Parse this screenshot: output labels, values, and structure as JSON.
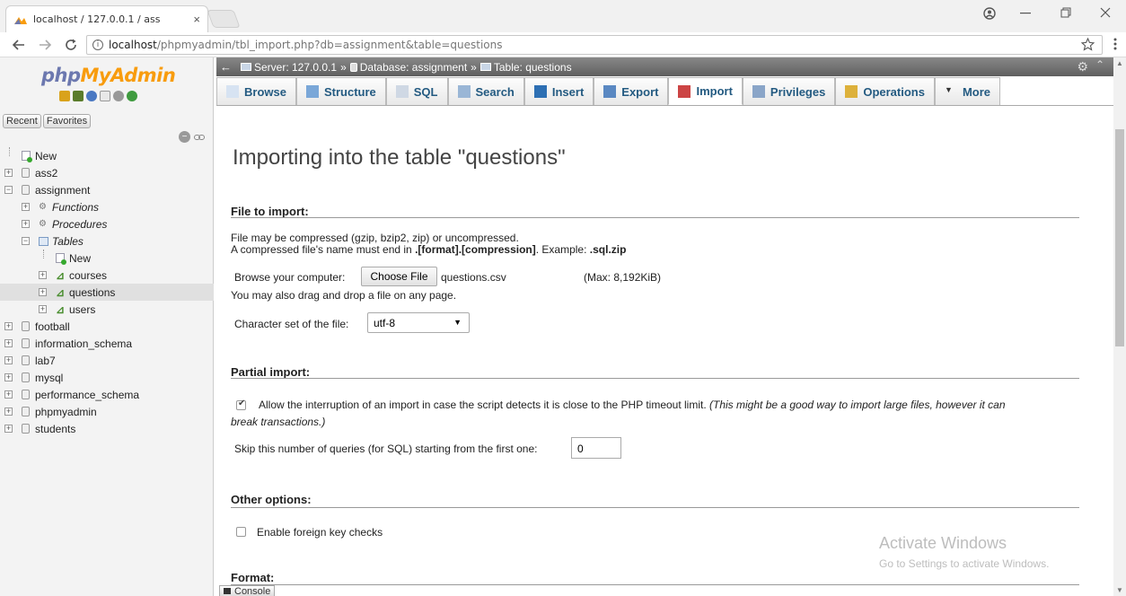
{
  "browser": {
    "tab_title": "localhost / 127.0.0.1 / ass",
    "tab_close": "×",
    "url_host": "localhost",
    "url_path": "/phpmyadmin/tbl_import.php?db=assignment&table=questions",
    "info_glyph": "i",
    "icons": [
      "phpmyadmin-favicon",
      "back-icon",
      "forward-icon",
      "reload-icon",
      "info-icon",
      "star-icon",
      "menu-icon",
      "account-icon",
      "minimize-icon",
      "restore-icon",
      "close-icon"
    ]
  },
  "sidebar": {
    "logo_php": "php",
    "logo_myadmin": "MyAdmin",
    "recent": "Recent",
    "favorites": "Favorites",
    "tree": [
      {
        "label": "New",
        "kind": "new",
        "level": 0
      },
      {
        "label": "ass2",
        "kind": "db",
        "level": 0
      },
      {
        "label": "assignment",
        "kind": "db",
        "level": 0,
        "expanded": true
      },
      {
        "label": "Functions",
        "kind": "fn",
        "level": 1
      },
      {
        "label": "Procedures",
        "kind": "fn",
        "level": 1
      },
      {
        "label": "Tables",
        "kind": "tables",
        "level": 1,
        "expanded": true
      },
      {
        "label": "New",
        "kind": "new",
        "level": 2
      },
      {
        "label": "courses",
        "kind": "table",
        "level": 2
      },
      {
        "label": "questions",
        "kind": "table",
        "level": 2,
        "selected": true
      },
      {
        "label": "users",
        "kind": "table",
        "level": 2
      },
      {
        "label": "football",
        "kind": "db",
        "level": 0
      },
      {
        "label": "information_schema",
        "kind": "db",
        "level": 0
      },
      {
        "label": "lab7",
        "kind": "db",
        "level": 0
      },
      {
        "label": "mysql",
        "kind": "db",
        "level": 0
      },
      {
        "label": "performance_schema",
        "kind": "db",
        "level": 0
      },
      {
        "label": "phpmyadmin",
        "kind": "db",
        "level": 0
      },
      {
        "label": "students",
        "kind": "db",
        "level": 0
      }
    ]
  },
  "breadcrumb": {
    "server": "Server: 127.0.0.1",
    "database": "Database: assignment",
    "table": "Table: questions",
    "separator": "»"
  },
  "tabs": [
    {
      "label": "Browse",
      "icon": "browse-icon"
    },
    {
      "label": "Structure",
      "icon": "structure-icon"
    },
    {
      "label": "SQL",
      "icon": "sql-icon"
    },
    {
      "label": "Search",
      "icon": "search-icon"
    },
    {
      "label": "Insert",
      "icon": "insert-icon"
    },
    {
      "label": "Export",
      "icon": "export-icon"
    },
    {
      "label": "Import",
      "icon": "import-icon",
      "active": true
    },
    {
      "label": "Privileges",
      "icon": "privileges-icon"
    },
    {
      "label": "Operations",
      "icon": "operations-icon"
    },
    {
      "label": "More",
      "icon": "more-icon"
    }
  ],
  "page": {
    "title": "Importing into the table \"questions\"",
    "file_section": {
      "title": "File to import:",
      "line1": "File may be compressed (gzip, bzip2, zip) or uncompressed.",
      "line2_prefix": "A compressed file's name must end in ",
      "line2_bold": ".[format].[compression]",
      "line2_mid": ". Example: ",
      "line2_example": ".sql.zip",
      "browse_label": "Browse your computer:",
      "choose_button": "Choose File",
      "chosen_file": "questions.csv",
      "max_size": "(Max: 8,192KiB)",
      "drag_hint": "You may also drag and drop a file on any page.",
      "charset_label": "Character set of the file:",
      "charset_value": "utf-8"
    },
    "partial_section": {
      "title": "Partial import:",
      "allow_interrupt_text": "Allow the interruption of an import in case the script detects it is close to the PHP timeout limit.",
      "allow_interrupt_note_1": "(This might be a good way to import large files, however it can",
      "allow_interrupt_note_2": "break transactions.)",
      "allow_interrupt_checked": true,
      "skip_label": "Skip this number of queries (for SQL) starting from the first one:",
      "skip_value": "0"
    },
    "other_section": {
      "title": "Other options:",
      "fk_label": "Enable foreign key checks",
      "fk_checked": false
    },
    "format_section": {
      "title": "Format:"
    }
  },
  "watermark": {
    "line1": "Activate Windows",
    "line2": "Go to Settings to activate Windows."
  },
  "console": {
    "label": "Console"
  },
  "colors": {
    "logo_php": "#6c78af",
    "logo_myadmin": "#f89c0e",
    "tab_text": "#235a81",
    "server_bar": "#6b6b6b"
  }
}
